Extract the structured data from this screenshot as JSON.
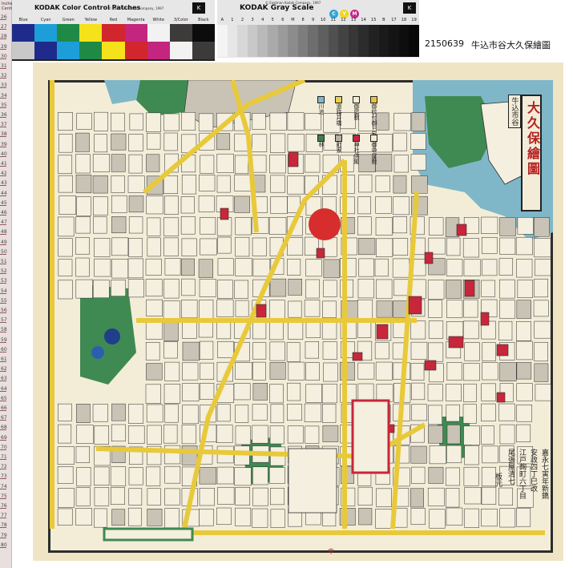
{
  "color_card": {
    "title": "KODAK Color Control Patches",
    "copyright": "© Eastman Kodak Company, 1997",
    "logo": "K",
    "labels": [
      "Blue",
      "Cyan",
      "Green",
      "Yellow",
      "Red",
      "Magenta",
      "White",
      "3/Color",
      "Black"
    ],
    "top_row_colors": [
      "#1f2b8a",
      "#1e9ed8",
      "#1f8a45",
      "#f5e21b",
      "#d1262e",
      "#c4257f",
      "#f2f2f2",
      "#3d3a3a",
      "#0c0c0c"
    ],
    "bottom_row_colors": [
      "#c9c9c9",
      "#1f2b8a",
      "#1e9ed8",
      "#1f8a45",
      "#f5e21b",
      "#d1262e",
      "#c4257f",
      "#f2f2f2",
      "#3d3a3a"
    ]
  },
  "gray_card": {
    "title": "KODAK Gray Scale",
    "copyright": "© Eastman Kodak Company, 1997",
    "dots": [
      {
        "letter": "C",
        "color": "#2aa6dc"
      },
      {
        "letter": "Y",
        "color": "#f0d61c"
      },
      {
        "letter": "M",
        "color": "#c8288a"
      }
    ],
    "logo": "K",
    "step_labels": [
      "A",
      "1",
      "2",
      "3",
      "4",
      "5",
      "6",
      "M",
      "8",
      "9",
      "10",
      "11",
      "12",
      "13",
      "14",
      "15",
      "B",
      "17",
      "18",
      "19"
    ],
    "step_grays": [
      "#f4f4f4",
      "#e6e6e6",
      "#d7d7d7",
      "#c8c8c8",
      "#b9b9b9",
      "#aaaaaa",
      "#9b9b9b",
      "#8c8c8c",
      "#7d7d7d",
      "#6e6e6e",
      "#5f5f5f",
      "#505050",
      "#434343",
      "#373737",
      "#2c2c2c",
      "#222222",
      "#1a1a1a",
      "#141414",
      "#0e0e0e",
      "#080808"
    ]
  },
  "ruler": {
    "unit_top": "Inches",
    "unit_bottom": "Centimetres",
    "numbers": [
      "26",
      "27",
      "28",
      "29",
      "30",
      "31",
      "32",
      "33",
      "34",
      "35",
      "36",
      "37",
      "38",
      "39",
      "40",
      "41",
      "42",
      "43",
      "44",
      "45",
      "46",
      "47",
      "48",
      "49",
      "50",
      "51",
      "52",
      "53",
      "54",
      "55",
      "56",
      "57",
      "58",
      "59",
      "60",
      "61",
      "62",
      "63",
      "64",
      "65",
      "66",
      "67",
      "68",
      "69",
      "70",
      "71",
      "72",
      "73",
      "74",
      "75",
      "76",
      "77",
      "78",
      "79",
      "80"
    ]
  },
  "caption": {
    "id": "2150639",
    "title": "牛込市谷大久保繪圖"
  },
  "map": {
    "title": "大久保繪圖",
    "subtitle": "牛込市谷",
    "legend": [
      {
        "text": "御紋付御三家",
        "color": "#e9c43a"
      },
      {
        "text": "御屋敷",
        "color": "#f4ecd2"
      },
      {
        "text": "道路并橋",
        "color": "#e8d24a"
      },
      {
        "text": "川池",
        "color": "#7fb7c9"
      },
      {
        "text": "御中屋敷",
        "color": "#f4ecd2"
      },
      {
        "text": "神社佛閣",
        "color": "#c8263a"
      },
      {
        "text": "町家",
        "color": "#b7b0a2"
      },
      {
        "text": "林",
        "color": "#3f7f4c"
      }
    ],
    "colophon": [
      "嘉永七寅年新鐫",
      "安政四丁巳改",
      "江戸麹町六丁目",
      "尾張屋清七"
    ],
    "publisher_label": "板元",
    "north_mark": "中",
    "colors": {
      "paper": "#efe5c4",
      "road": "#e8c93a",
      "block": "#f4efde",
      "gray_block": "#c9c3b6",
      "shrine": "#c8263a",
      "water": "#7fb7c9",
      "green": "#3f8a52",
      "frame": "#2c2c2c",
      "sun": "#d72d2d"
    }
  }
}
